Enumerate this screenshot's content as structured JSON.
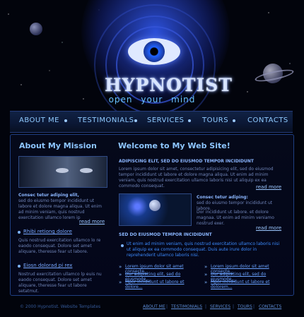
{
  "brand": {
    "title": "HYPNOTIST",
    "subtitle": "open your mind"
  },
  "nav": {
    "items": [
      "ABOUT ME",
      "TESTIMONIALS",
      "SERVICES",
      "TOURS",
      "CONTACTS"
    ]
  },
  "mission": {
    "title": "About My Mission",
    "subtitle": "Consec tetur adiping elit,",
    "paragraph": "sed do eiusmo tempor incididunt ut labore et dolore magna aliqua. Ut enim ad minim veniam, quis nostrud exercitation ullamco lorem ip",
    "read_more": "read more",
    "item1_title": "Rhibi retiong dolore",
    "item1_text": "Quis nostrud exercitation ullamco lo re eaodo consequat. Dolore set amet aliquare, theresse fear ut labore.",
    "item2_title": "Eiosn dolorad pi rex",
    "item2_text": "Nostrud exercitation ullamco lp euis nu eaodo consequat. Dolore set amet aliquare, theresse fear ut labore setatmut."
  },
  "welcome": {
    "title": "Welcome to My Web Site!",
    "lead": "ADIPISCING ELIT, SED DO EIUSMOD TEMPOR INCIDIDUNT",
    "lead_text": "Lorem ipsum dolor sit amet, consectetur adipisicing elit, sed do eiusmod tempor incididunt ut labore et dolore magna aliqua. Ut enim ad minim veniam, quis nostrud exercitation ullamco laboris nisi ut aliquip ex ea commodo consequat.",
    "read_more": "read more",
    "sub_title": "Consec tetur adiping:",
    "sub_text1": "sed do eiusmo tempor incididunt ut labore.",
    "sub_text2": "Dor incididunt ut labore. et dolore magnaa. Ut enim ad minim veniamo nostrud exer.",
    "section2_title": "SED DO EIUSMOD TEMPOR INCIDIDUNT",
    "section2_text": "Ut enim ad minim veniam, quis nostrud exercitation ullamco laboris nisi ut aliquip ex ea commodo consequat. Duis aute irure dolor in reprehenderit ullamco laboris nisi.",
    "links_left": [
      "Lorem ipsum dolor sit amet consecte...",
      "Dur adipiscing elit, sed do eiusmode...",
      "Mpor incididunt ut labore et dolore..."
    ],
    "links_right": [
      "Lorem ipsum dolor sit amet consecte...",
      "Dur adipiscing elit, sed do eiusmode...",
      "Mpor incididunt ut labore et dolorem..."
    ]
  },
  "footer": {
    "copyright": "© 2000 Hypnotist. Website Templates",
    "links": [
      "ABOUT ME",
      "TESTIMONIALS",
      "SERVICES",
      "TOURS",
      "CONTACTS"
    ]
  },
  "icons": {
    "hero": "eye-icon",
    "nav_separator": "dot-icon",
    "bullet": "dot-icon",
    "link_arrow": "double-chevron-right-icon"
  },
  "colors": {
    "background": "#02040c",
    "accent": "#8ec6ff",
    "text": "#6f84b8",
    "link": "#6aa2ff"
  }
}
